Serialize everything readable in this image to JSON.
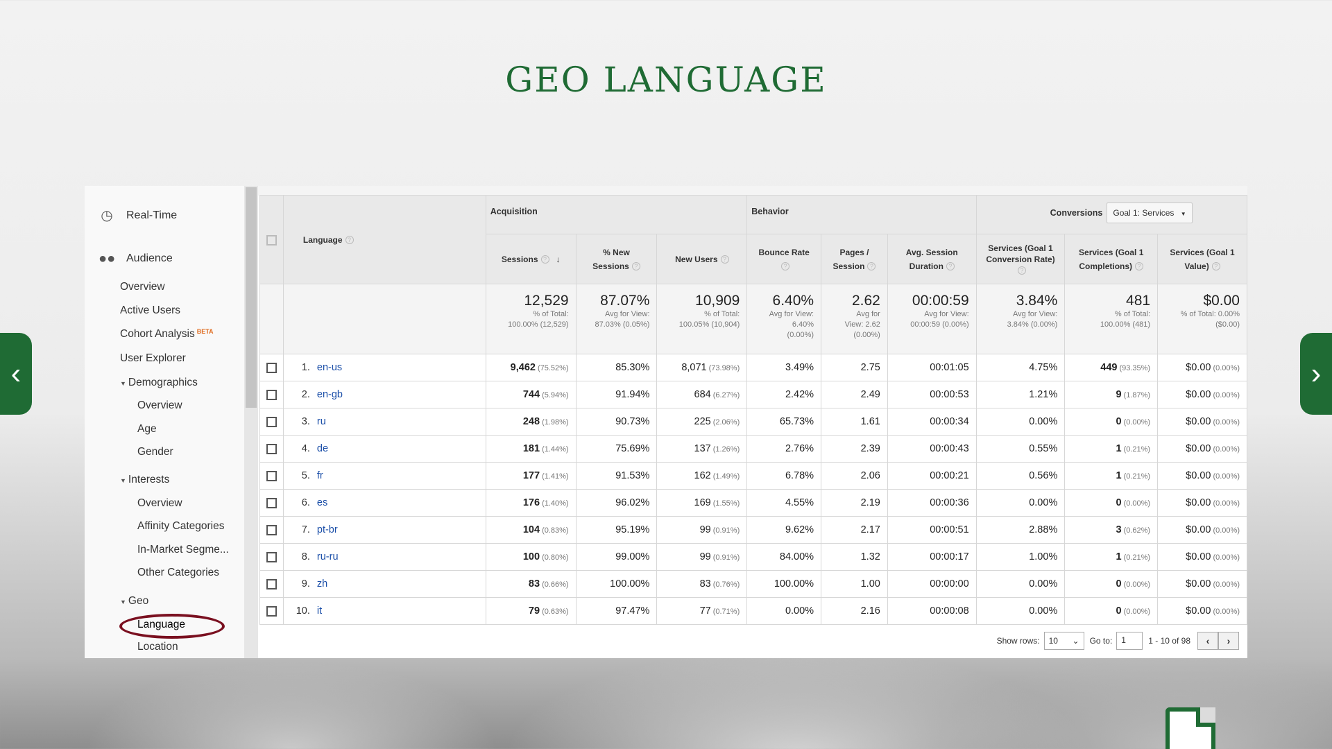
{
  "slide": {
    "title": "GEO LANGUAGE"
  },
  "sidebar": {
    "realtime": "Real-Time",
    "audience": "Audience",
    "items": {
      "overview": "Overview",
      "active_users": "Active Users",
      "cohort": "Cohort Analysis",
      "cohort_badge": "BETA",
      "user_explorer": "User Explorer",
      "demographics": "Demographics",
      "demo_overview": "Overview",
      "age": "Age",
      "gender": "Gender",
      "interests": "Interests",
      "int_overview": "Overview",
      "affinity": "Affinity Categories",
      "in_market": "In-Market Segme...",
      "other": "Other Categories",
      "geo": "Geo",
      "language": "Language",
      "location": "Location"
    }
  },
  "table": {
    "groups": {
      "acquisition": "Acquisition",
      "behavior": "Behavior",
      "conversions": "Conversions",
      "goal_select": "Goal 1: Services"
    },
    "columns": {
      "language": "Language",
      "sessions": "Sessions",
      "new_sessions_1": "% New",
      "new_sessions_2": "Sessions",
      "new_users": "New Users",
      "bounce": "Bounce Rate",
      "pages_1": "Pages /",
      "pages_2": "Session",
      "duration_1": "Avg. Session",
      "duration_2": "Duration",
      "conv_rate_1": "Services (Goal 1",
      "conv_rate_2": "Conversion Rate)",
      "completions_1": "Services (Goal 1",
      "completions_2": "Completions)",
      "value_1": "Services (Goal 1",
      "value_2": "Value)"
    },
    "totals": {
      "sessions": "12,529",
      "sessions_sub1": "% of Total:",
      "sessions_sub2": "100.00% (12,529)",
      "new_sessions": "87.07%",
      "new_sessions_sub1": "Avg for View:",
      "new_sessions_sub2": "87.03% (0.05%)",
      "new_users": "10,909",
      "new_users_sub1": "% of Total:",
      "new_users_sub2": "100.05% (10,904)",
      "bounce": "6.40%",
      "bounce_sub1": "Avg for View:",
      "bounce_sub2": "6.40%",
      "bounce_sub3": "(0.00%)",
      "pages": "2.62",
      "pages_sub1": "Avg for",
      "pages_sub2": "View: 2.62",
      "pages_sub3": "(0.00%)",
      "duration": "00:00:59",
      "duration_sub1": "Avg for View:",
      "duration_sub2": "00:00:59 (0.00%)",
      "conv_rate": "3.84%",
      "conv_rate_sub1": "Avg for View:",
      "conv_rate_sub2": "3.84% (0.00%)",
      "completions": "481",
      "completions_sub1": "% of Total:",
      "completions_sub2": "100.00% (481)",
      "value": "$0.00",
      "value_sub1": "% of Total: 0.00%",
      "value_sub2": "($0.00)"
    },
    "rows": [
      {
        "n": "1.",
        "lang": "en-us",
        "sessions": "9,462",
        "sessions_pct": "(75.52%)",
        "new_sessions": "85.30%",
        "new_users": "8,071",
        "new_users_pct": "(73.98%)",
        "bounce": "3.49%",
        "pages": "2.75",
        "duration": "00:01:05",
        "conv_rate": "4.75%",
        "completions": "449",
        "completions_pct": "(93.35%)",
        "value": "$0.00",
        "value_pct": "(0.00%)"
      },
      {
        "n": "2.",
        "lang": "en-gb",
        "sessions": "744",
        "sessions_pct": "(5.94%)",
        "new_sessions": "91.94%",
        "new_users": "684",
        "new_users_pct": "(6.27%)",
        "bounce": "2.42%",
        "pages": "2.49",
        "duration": "00:00:53",
        "conv_rate": "1.21%",
        "completions": "9",
        "completions_pct": "(1.87%)",
        "value": "$0.00",
        "value_pct": "(0.00%)"
      },
      {
        "n": "3.",
        "lang": "ru",
        "sessions": "248",
        "sessions_pct": "(1.98%)",
        "new_sessions": "90.73%",
        "new_users": "225",
        "new_users_pct": "(2.06%)",
        "bounce": "65.73%",
        "pages": "1.61",
        "duration": "00:00:34",
        "conv_rate": "0.00%",
        "completions": "0",
        "completions_pct": "(0.00%)",
        "value": "$0.00",
        "value_pct": "(0.00%)"
      },
      {
        "n": "4.",
        "lang": "de",
        "sessions": "181",
        "sessions_pct": "(1.44%)",
        "new_sessions": "75.69%",
        "new_users": "137",
        "new_users_pct": "(1.26%)",
        "bounce": "2.76%",
        "pages": "2.39",
        "duration": "00:00:43",
        "conv_rate": "0.55%",
        "completions": "1",
        "completions_pct": "(0.21%)",
        "value": "$0.00",
        "value_pct": "(0.00%)"
      },
      {
        "n": "5.",
        "lang": "fr",
        "sessions": "177",
        "sessions_pct": "(1.41%)",
        "new_sessions": "91.53%",
        "new_users": "162",
        "new_users_pct": "(1.49%)",
        "bounce": "6.78%",
        "pages": "2.06",
        "duration": "00:00:21",
        "conv_rate": "0.56%",
        "completions": "1",
        "completions_pct": "(0.21%)",
        "value": "$0.00",
        "value_pct": "(0.00%)"
      },
      {
        "n": "6.",
        "lang": "es",
        "sessions": "176",
        "sessions_pct": "(1.40%)",
        "new_sessions": "96.02%",
        "new_users": "169",
        "new_users_pct": "(1.55%)",
        "bounce": "4.55%",
        "pages": "2.19",
        "duration": "00:00:36",
        "conv_rate": "0.00%",
        "completions": "0",
        "completions_pct": "(0.00%)",
        "value": "$0.00",
        "value_pct": "(0.00%)"
      },
      {
        "n": "7.",
        "lang": "pt-br",
        "sessions": "104",
        "sessions_pct": "(0.83%)",
        "new_sessions": "95.19%",
        "new_users": "99",
        "new_users_pct": "(0.91%)",
        "bounce": "9.62%",
        "pages": "2.17",
        "duration": "00:00:51",
        "conv_rate": "2.88%",
        "completions": "3",
        "completions_pct": "(0.62%)",
        "value": "$0.00",
        "value_pct": "(0.00%)"
      },
      {
        "n": "8.",
        "lang": "ru-ru",
        "sessions": "100",
        "sessions_pct": "(0.80%)",
        "new_sessions": "99.00%",
        "new_users": "99",
        "new_users_pct": "(0.91%)",
        "bounce": "84.00%",
        "pages": "1.32",
        "duration": "00:00:17",
        "conv_rate": "1.00%",
        "completions": "1",
        "completions_pct": "(0.21%)",
        "value": "$0.00",
        "value_pct": "(0.00%)"
      },
      {
        "n": "9.",
        "lang": "zh",
        "sessions": "83",
        "sessions_pct": "(0.66%)",
        "new_sessions": "100.00%",
        "new_users": "83",
        "new_users_pct": "(0.76%)",
        "bounce": "100.00%",
        "pages": "1.00",
        "duration": "00:00:00",
        "conv_rate": "0.00%",
        "completions": "0",
        "completions_pct": "(0.00%)",
        "value": "$0.00",
        "value_pct": "(0.00%)"
      },
      {
        "n": "10.",
        "lang": "it",
        "sessions": "79",
        "sessions_pct": "(0.63%)",
        "new_sessions": "97.47%",
        "new_users": "77",
        "new_users_pct": "(0.71%)",
        "bounce": "0.00%",
        "pages": "2.16",
        "duration": "00:00:08",
        "conv_rate": "0.00%",
        "completions": "0",
        "completions_pct": "(0.00%)",
        "value": "$0.00",
        "value_pct": "(0.00%)"
      }
    ]
  },
  "pager": {
    "show_rows_label": "Show rows:",
    "rows_value": "10",
    "goto_label": "Go to:",
    "goto_value": "1",
    "range": "1 - 10 of 98"
  },
  "colors": {
    "accent_green": "#1f6b34",
    "link_blue": "#1a4ea8",
    "circle_red": "#7a1020"
  }
}
